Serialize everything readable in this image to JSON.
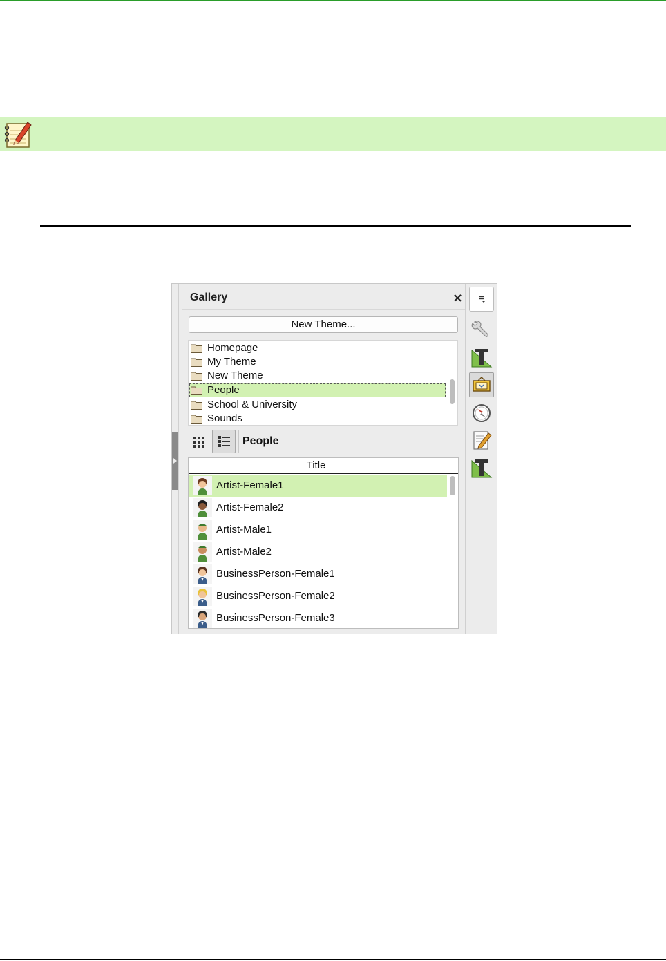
{
  "gallery": {
    "title": "Gallery",
    "close_glyph": "×",
    "new_theme_label": "New Theme...",
    "themes": [
      {
        "label": "Homepage",
        "selected": false
      },
      {
        "label": "My Theme",
        "selected": false
      },
      {
        "label": "New Theme",
        "selected": false
      },
      {
        "label": "People",
        "selected": true
      },
      {
        "label": "School & University",
        "selected": false
      },
      {
        "label": "Sounds",
        "selected": false
      }
    ],
    "current_theme": "People",
    "table": {
      "column_title": "Title",
      "rows": [
        {
          "label": "Artist-Female1",
          "selected": true,
          "icon": "artist-female-icon"
        },
        {
          "label": "Artist-Female2",
          "selected": false,
          "icon": "artist-female-icon"
        },
        {
          "label": "Artist-Male1",
          "selected": false,
          "icon": "artist-male-icon"
        },
        {
          "label": "Artist-Male2",
          "selected": false,
          "icon": "artist-male-icon"
        },
        {
          "label": "BusinessPerson-Female1",
          "selected": false,
          "icon": "businessperson-female-icon"
        },
        {
          "label": "BusinessPerson-Female2",
          "selected": false,
          "icon": "businessperson-female-icon"
        },
        {
          "label": "BusinessPerson-Female3",
          "selected": false,
          "icon": "businessperson-female-icon"
        }
      ]
    },
    "sidebar_tabs": [
      "sidebar-menu-icon",
      "properties-wrench-icon",
      "styles-icon",
      "gallery-icon",
      "navigator-icon",
      "manage-changes-icon",
      "styles-icon"
    ]
  },
  "colors": {
    "top_rule": "#2a9d2a",
    "note_bar": "#d4f5c0",
    "selection": "#d2f1b2"
  }
}
